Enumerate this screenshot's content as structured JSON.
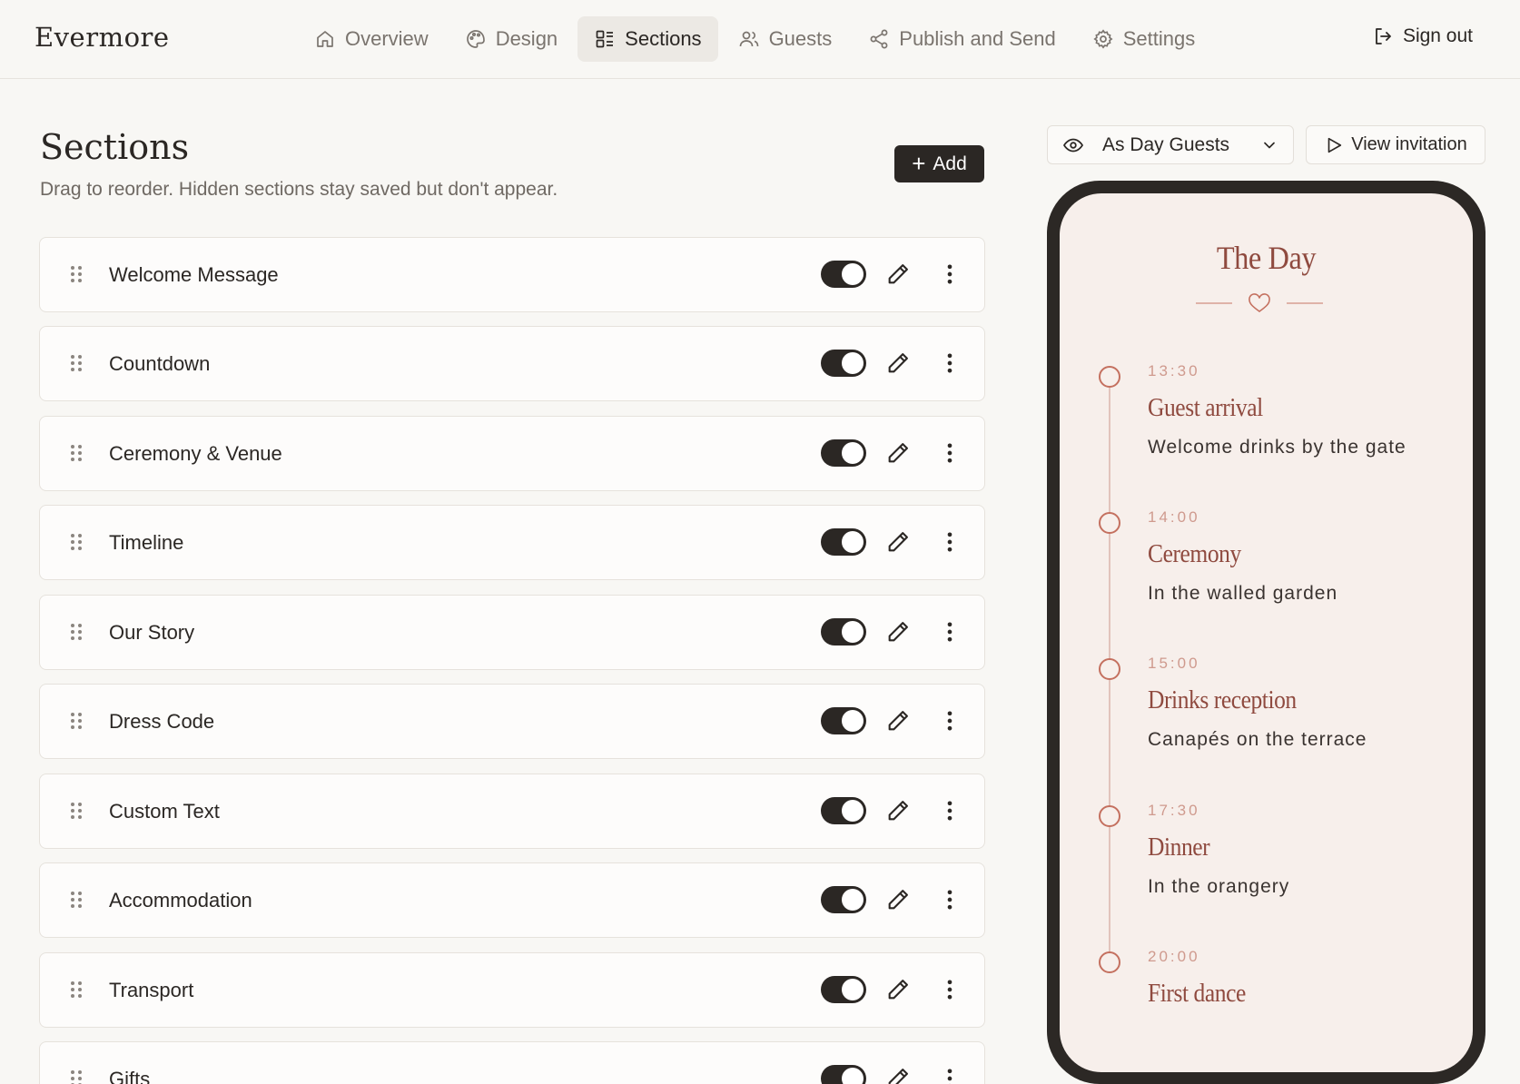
{
  "brand": "Evermore",
  "nav": [
    {
      "label": "Overview",
      "icon": "home-icon",
      "active": false
    },
    {
      "label": "Design",
      "icon": "palette-icon",
      "active": false
    },
    {
      "label": "Sections",
      "icon": "sections-icon",
      "active": true
    },
    {
      "label": "Guests",
      "icon": "users-icon",
      "active": false
    },
    {
      "label": "Publish and Send",
      "icon": "share-icon",
      "active": false
    },
    {
      "label": "Settings",
      "icon": "gear-icon",
      "active": false
    }
  ],
  "signout": "Sign out",
  "page": {
    "title": "Sections",
    "subtitle": "Drag to reorder. Hidden sections stay saved but don't appear.",
    "add_label": "Add"
  },
  "sections": [
    {
      "label": "Welcome Message",
      "visible": true
    },
    {
      "label": "Countdown",
      "visible": true
    },
    {
      "label": "Ceremony & Venue",
      "visible": true
    },
    {
      "label": "Timeline",
      "visible": true
    },
    {
      "label": "Our Story",
      "visible": true
    },
    {
      "label": "Dress Code",
      "visible": true
    },
    {
      "label": "Custom Text",
      "visible": true
    },
    {
      "label": "Accommodation",
      "visible": true
    },
    {
      "label": "Transport",
      "visible": true
    },
    {
      "label": "Gifts",
      "visible": true
    }
  ],
  "preview": {
    "view_as": "As Day Guests",
    "view_invitation": "View invitation",
    "title": "The Day",
    "accent_color": "#8f4a3f",
    "timeline": [
      {
        "time": "13:30",
        "name": "Guest arrival",
        "desc": "Welcome drinks by the gate"
      },
      {
        "time": "14:00",
        "name": "Ceremony",
        "desc": "In the walled garden"
      },
      {
        "time": "15:00",
        "name": "Drinks reception",
        "desc": "Canapés on the terrace"
      },
      {
        "time": "17:30",
        "name": "Dinner",
        "desc": "In the orangery"
      },
      {
        "time": "20:00",
        "name": "First dance",
        "desc": ""
      }
    ]
  }
}
